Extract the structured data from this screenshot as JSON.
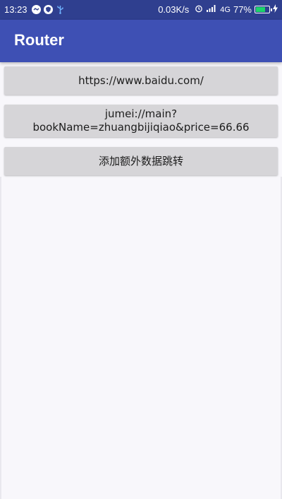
{
  "status_bar": {
    "time": "13:23",
    "net_speed": "0.03K/s",
    "network_type": "4G",
    "battery_percent_label": "77%",
    "battery_level": 0.77,
    "icons": [
      "notification-icon",
      "shield-icon",
      "usb-icon",
      "alarm-icon",
      "signal-icon",
      "battery-icon",
      "charging-icon"
    ]
  },
  "app_bar": {
    "title": "Router"
  },
  "buttons": [
    {
      "label": "https://www.baidu.com/"
    },
    {
      "label_line1": "jumei://main?",
      "label_line2": "bookName=zhuangbijiqiao&price=66.66"
    },
    {
      "label": "添加额外数据跳转"
    }
  ],
  "colors": {
    "status_bar": "#2f3f8f",
    "app_bar": "#3e50b4",
    "button": "#d6d5d8",
    "background": "#f8f7fb"
  }
}
